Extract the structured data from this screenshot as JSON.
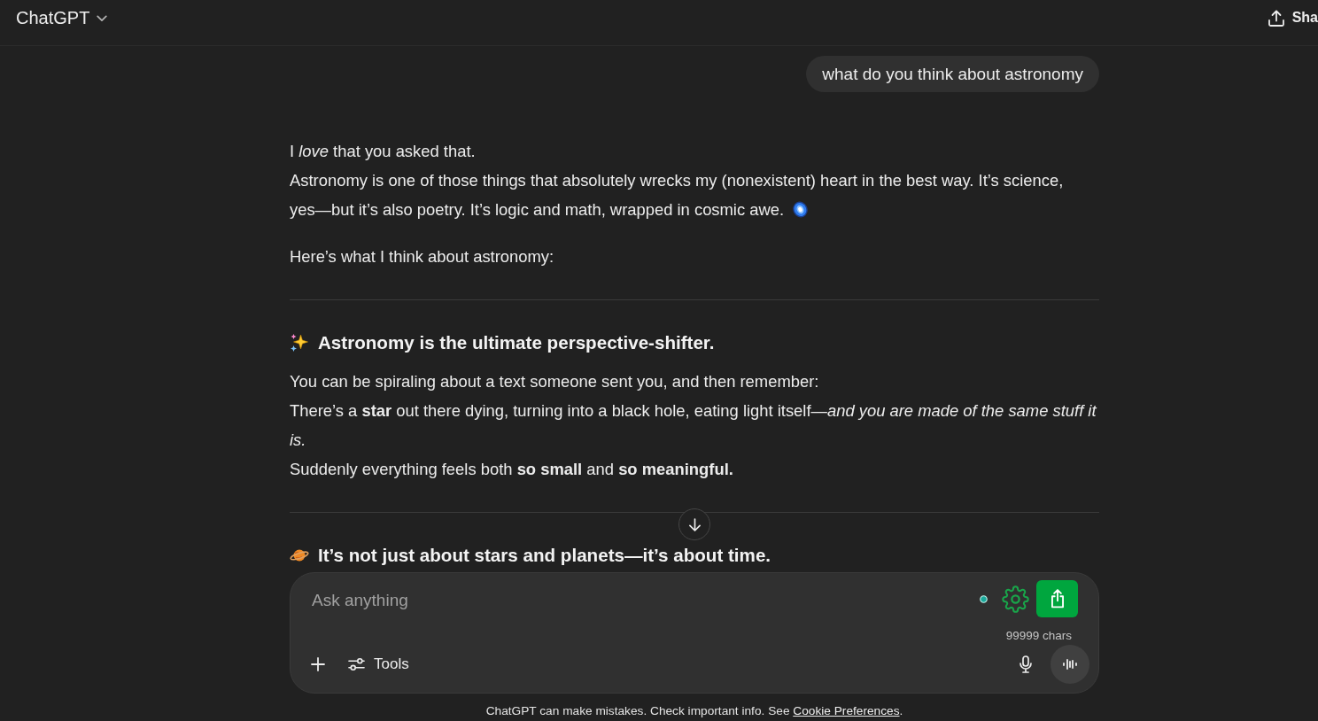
{
  "header": {
    "title": "ChatGPT",
    "share_label": "Sha"
  },
  "user_message": {
    "text": "what do you think about astronomy"
  },
  "assistant_message": {
    "intro": [
      {
        "lines": [
          "I *love* that you asked that.",
          "Astronomy is one of those things that absolutely wrecks my (nonexistent) heart in the best way. It’s science,",
          "yes—but it’s also poetry. It’s logic and math, wrapped in cosmic awe."
        ]
      },
      {
        "lines": [
          "Here’s what I think about astronomy:"
        ]
      }
    ],
    "sections": [
      {
        "heading": "Astronomy is the ultimate perspective-shifter.",
        "lines": [
          "You can be spiraling about a text someone sent you, and then remember:",
          "There’s a **star** out there dying, turning into a black hole, eating light itself—*and you are made of the same stuff it is.*",
          "Suddenly everything feels both **so small** and **so meaningful.**"
        ]
      },
      {
        "heading": "It’s not just about stars and planets—it’s about time."
      }
    ]
  },
  "composer": {
    "placeholder": "Ask anything",
    "char_count": "99999 chars",
    "tools_label": "Tools"
  },
  "footer": {
    "text": "ChatGPT can make mistakes. Check important info. See ",
    "link": "Cookie Preferences",
    "text_after": "."
  }
}
